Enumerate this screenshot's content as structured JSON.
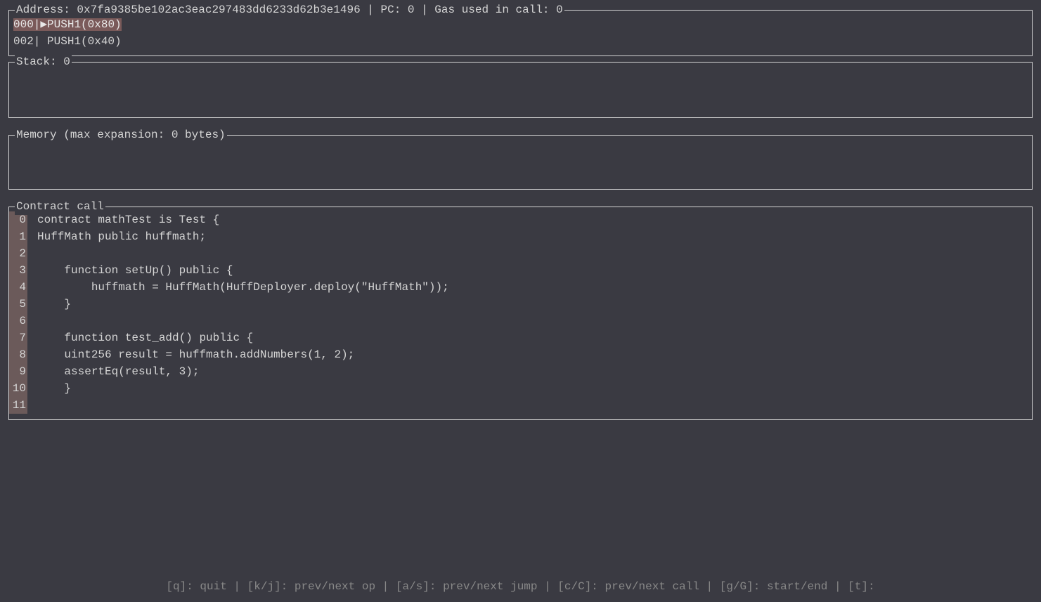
{
  "address_panel": {
    "title": "Address: 0x7fa9385be102ac3eac297483dd6233d62b3e1496 | PC: 0 | Gas used in call: 0",
    "ops": [
      {
        "offset": "000",
        "marker": "▶",
        "op": "PUSH1(0x80)",
        "highlight": true
      },
      {
        "offset": "002",
        "marker": " ",
        "op": "PUSH1(0x40)",
        "highlight": false
      }
    ]
  },
  "stack_panel": {
    "title": "Stack: 0"
  },
  "memory_panel": {
    "title": "Memory (max expansion: 0 bytes)"
  },
  "contract_panel": {
    "title": "Contract call",
    "lines": [
      {
        "num": "0",
        "text": "contract mathTest is Test {"
      },
      {
        "num": "1",
        "text": "HuffMath public huffmath;"
      },
      {
        "num": "2",
        "text": ""
      },
      {
        "num": "3",
        "text": "    function setUp() public {"
      },
      {
        "num": "4",
        "text": "        huffmath = HuffMath(HuffDeployer.deploy(\"HuffMath\"));"
      },
      {
        "num": "5",
        "text": "    }"
      },
      {
        "num": "6",
        "text": ""
      },
      {
        "num": "7",
        "text": "    function test_add() public {"
      },
      {
        "num": "8",
        "text": "    uint256 result = huffmath.addNumbers(1, 2);"
      },
      {
        "num": "9",
        "text": "    assertEq(result, 3);"
      },
      {
        "num": "10",
        "text": "    }"
      },
      {
        "num": "11",
        "text": ""
      }
    ]
  },
  "footer": {
    "hints": "[q]: quit | [k/j]: prev/next op | [a/s]: prev/next jump | [c/C]: prev/next call | [g/G]: start/end | [t]:"
  }
}
